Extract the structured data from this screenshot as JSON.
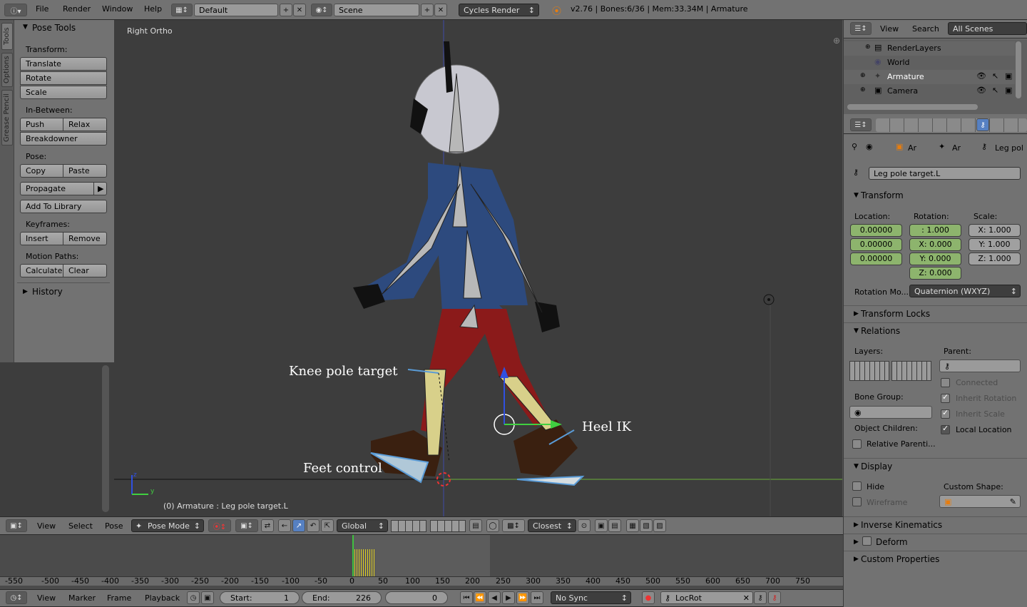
{
  "topbar": {
    "menus": [
      "File",
      "Render",
      "Window",
      "Help"
    ],
    "layout": "Default",
    "scene": "Scene",
    "engine": "Cycles Render",
    "status": "v2.76 | Bones:6/36 | Mem:33.34M | Armature"
  },
  "toolshelf": {
    "tabs": [
      "Tools",
      "Options",
      "Grease Pencil"
    ],
    "title": "Pose Tools",
    "transform_label": "Transform:",
    "translate": "Translate",
    "rotate": "Rotate",
    "scale": "Scale",
    "inbetween_label": "In-Between:",
    "push": "Push",
    "relax": "Relax",
    "breakdowner": "Breakdowner",
    "pose_label": "Pose:",
    "copy": "Copy",
    "paste": "Paste",
    "propagate": "Propagate",
    "add_to_library": "Add To Library",
    "keyframes_label": "Keyframes:",
    "insert": "Insert",
    "remove": "Remove",
    "motion_paths_label": "Motion Paths:",
    "calculate": "Calculate",
    "clear": "Clear",
    "history": "History"
  },
  "viewport": {
    "view_name": "Right Ortho",
    "status": "(0) Armature : Leg pole target.L",
    "annotations": {
      "knee": "Knee pole target",
      "heel": "Heel IK",
      "feet": "Feet control"
    },
    "axis_z": "z",
    "axis_y": "y"
  },
  "viewport_header": {
    "view": "View",
    "select": "Select",
    "pose": "Pose",
    "mode": "Pose Mode",
    "orientation": "Global",
    "snap": "Closest"
  },
  "outliner": {
    "view": "View",
    "search": "Search",
    "filter": "All Scenes",
    "items": [
      {
        "label": "RenderLayers"
      },
      {
        "label": "World"
      },
      {
        "label": "Armature"
      },
      {
        "label": "Camera"
      }
    ]
  },
  "properties": {
    "breadcrumb": [
      "Ar",
      "Ar",
      "Leg pol"
    ],
    "bone_name": "Leg pole target.L",
    "transform": {
      "title": "Transform",
      "location_label": "Location:",
      "rotation_label": "Rotation:",
      "scale_label": "Scale:",
      "location": [
        "0.00000",
        "0.00000",
        "0.00000"
      ],
      "rotation": [
        ":   1.000",
        "X: 0.000",
        "Y: 0.000",
        "Z: 0.000"
      ],
      "scale": [
        "X: 1.000",
        "Y: 1.000",
        "Z: 1.000"
      ],
      "rotation_mode_label": "Rotation Mo...",
      "rotation_mode": "Quaternion (WXYZ)"
    },
    "transform_locks": "Transform Locks",
    "relations": {
      "title": "Relations",
      "layers_label": "Layers:",
      "parent_label": "Parent:",
      "connected": "Connected",
      "inherit_rotation": "Inherit Rotation",
      "bone_group_label": "Bone Group:",
      "inherit_scale": "Inherit Scale",
      "object_children_label": "Object Children:",
      "local_location": "Local Location",
      "relative_parenting": "Relative Parenti..."
    },
    "display": {
      "title": "Display",
      "hide": "Hide",
      "custom_shape_label": "Custom Shape:",
      "wireframe": "Wireframe"
    },
    "inverse_kinematics": "Inverse Kinematics",
    "deform": "Deform",
    "custom_properties": "Custom Properties"
  },
  "timeline": {
    "ticks": [
      "-550",
      "-500",
      "-450",
      "-400",
      "-350",
      "-300",
      "-250",
      "-200",
      "-150",
      "-100",
      "-50",
      "0",
      "50",
      "100",
      "150",
      "200",
      "250",
      "300",
      "350",
      "400",
      "450",
      "500",
      "550",
      "600",
      "650",
      "700",
      "750"
    ]
  },
  "timeline_header": {
    "view": "View",
    "marker": "Marker",
    "frame": "Frame",
    "playback": "Playback",
    "start": "Start:",
    "start_val": "1",
    "end": "End:",
    "end_val": "226",
    "current": "0",
    "sync": "No Sync",
    "keying_set": "LocRot"
  },
  "colors": {
    "accent_green": "#8db46d",
    "selected_bone": "#5a9bd6",
    "header": "#727272"
  }
}
